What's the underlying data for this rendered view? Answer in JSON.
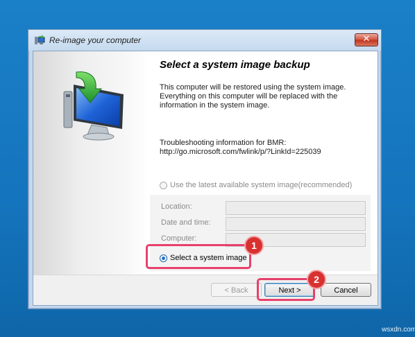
{
  "window": {
    "title": "Re-image your computer",
    "close_glyph": "✕"
  },
  "page": {
    "heading": "Select a system image backup",
    "description": "This computer will be restored using the system image. Everything on this computer will be replaced with the information in the system image.",
    "trouble_label": "Troubleshooting information for BMR:",
    "trouble_link": "http://go.microsoft.com/fwlink/p/?LinkId=225039"
  },
  "options": {
    "latest_label": "Use the latest available system image(recommended)",
    "latest_selected": false,
    "select_label": "Select a system image",
    "select_selected": true
  },
  "fields": {
    "location_label": "Location:",
    "location_value": "",
    "datetime_label": "Date and time:",
    "datetime_value": "",
    "computer_label": "Computer:",
    "computer_value": ""
  },
  "buttons": {
    "back_label": "< Back",
    "next_label": "Next >",
    "cancel_label": "Cancel"
  },
  "annotations": {
    "step1": "1",
    "step2": "2",
    "highlight_color": "#e8406b",
    "badge_color": "#d8312f"
  },
  "watermark": "wsxdn.com",
  "icons": [
    "restore-computer-icon",
    "window-app-icon",
    "close-icon"
  ]
}
